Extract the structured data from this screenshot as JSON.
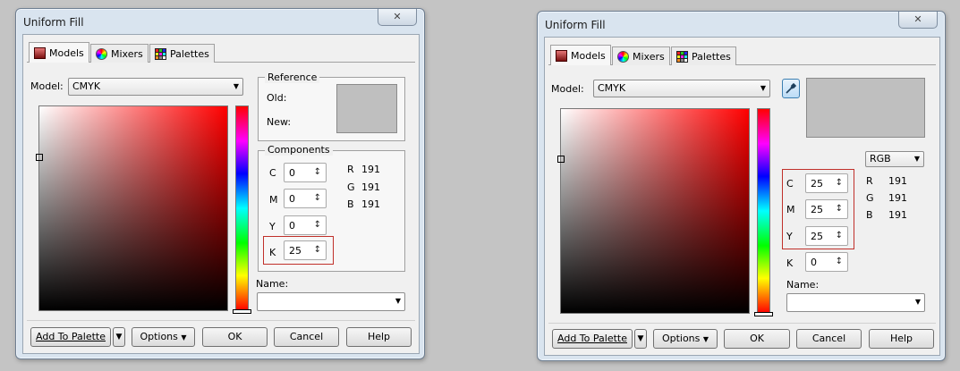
{
  "dialogs": [
    {
      "title": "Uniform Fill",
      "close_glyph": "✕",
      "tabs": [
        "Models",
        "Mixers",
        "Palettes"
      ],
      "model_label": "Model:",
      "model_value": "CMYK",
      "reference": {
        "title": "Reference",
        "old_label": "Old:",
        "new_label": "New:",
        "swatch_color": "#bfbfbf"
      },
      "components": {
        "title": "Components",
        "inputs": [
          {
            "label": "C",
            "value": "0"
          },
          {
            "label": "M",
            "value": "0"
          },
          {
            "label": "Y",
            "value": "0"
          },
          {
            "label": "K",
            "value": "25"
          }
        ],
        "rgb": [
          {
            "label": "R",
            "value": "191"
          },
          {
            "label": "G",
            "value": "191"
          },
          {
            "label": "B",
            "value": "191"
          }
        ]
      },
      "name_label": "Name:",
      "buttons": {
        "add_to_palette": "Add To Palette",
        "options": "Options",
        "ok": "OK",
        "cancel": "Cancel",
        "help": "Help"
      }
    },
    {
      "title": "Uniform Fill",
      "close_glyph": "✕",
      "tabs": [
        "Models",
        "Mixers",
        "Palettes"
      ],
      "model_label": "Model:",
      "model_value": "CMYK",
      "swatch_color": "#bfbfbf",
      "rgb_dropdown": "RGB",
      "components": {
        "inputs": [
          {
            "label": "C",
            "value": "25"
          },
          {
            "label": "M",
            "value": "25"
          },
          {
            "label": "Y",
            "value": "25"
          },
          {
            "label": "K",
            "value": "0"
          }
        ],
        "rgb": [
          {
            "label": "R",
            "value": "191"
          },
          {
            "label": "G",
            "value": "191"
          },
          {
            "label": "B",
            "value": "191"
          }
        ]
      },
      "name_label": "Name:",
      "buttons": {
        "add_to_palette": "Add To Palette",
        "options": "Options",
        "ok": "OK",
        "cancel": "Cancel",
        "help": "Help"
      }
    }
  ],
  "icons": {
    "dropdown": "▼",
    "spinner": "▲▼",
    "split_arrow": "▼",
    "eyedropper": "eyedropper-icon"
  },
  "colors": {
    "highlight_box": "#c0302a",
    "dialog_frame": "#d9e4ef"
  }
}
